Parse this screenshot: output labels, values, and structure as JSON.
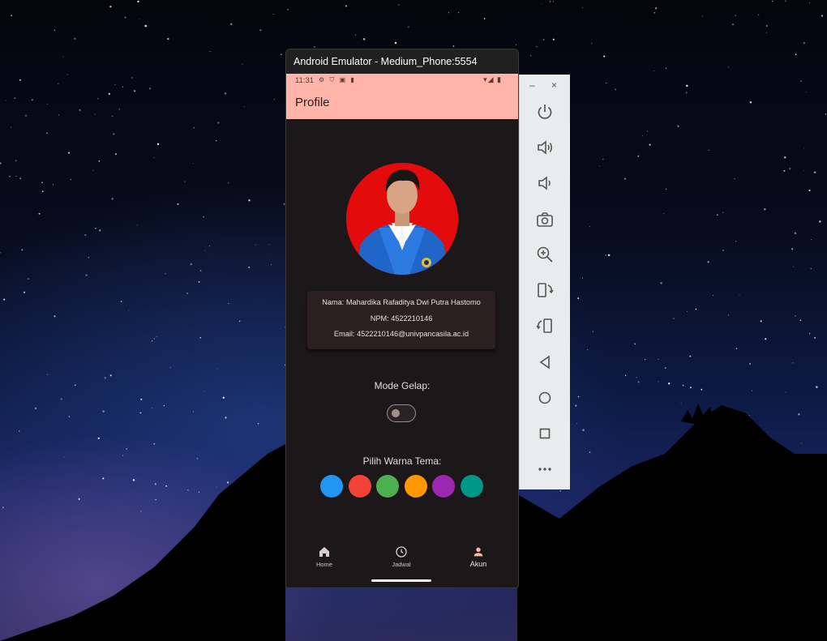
{
  "emulator": {
    "title": "Android Emulator - Medium_Phone:5554",
    "window_controls": {
      "minimize": "–",
      "close": "×"
    },
    "toolbar": [
      {
        "name": "power-icon"
      },
      {
        "name": "volume-up-icon"
      },
      {
        "name": "volume-down-icon"
      },
      {
        "name": "camera-icon"
      },
      {
        "name": "zoom-icon"
      },
      {
        "name": "rotate-left-icon"
      },
      {
        "name": "rotate-right-icon"
      },
      {
        "name": "back-icon"
      },
      {
        "name": "home-icon"
      },
      {
        "name": "overview-icon"
      },
      {
        "name": "more-icon"
      }
    ]
  },
  "status_bar": {
    "time": "11:31",
    "left_icons": "⚙ ⛉ ▣ ▮",
    "right_icons": "▾◢ ▮"
  },
  "app_bar": {
    "title": "Profile"
  },
  "profile": {
    "name_line": "Nama: Mahardika Rafaditya Dwi Putra Hastomo",
    "npm_line": "NPM: 4522210146",
    "email_line": "Email: 4522210146@univpancasila.ac.id"
  },
  "dark_mode": {
    "label": "Mode Gelap:",
    "enabled": false
  },
  "theme": {
    "label": "Pilih Warna Tema:",
    "colors": [
      "#2196f3",
      "#f44336",
      "#4caf50",
      "#ff9800",
      "#9c27b0",
      "#009688"
    ]
  },
  "bottom_nav": {
    "items": [
      {
        "label": "Home",
        "icon": "home-icon"
      },
      {
        "label": "Jadwal",
        "icon": "clock-icon"
      },
      {
        "label": "Akun",
        "icon": "person-icon",
        "active": true
      }
    ]
  },
  "colors": {
    "app_bar": "#ffb4a9",
    "background": "#1c1819",
    "card": "#2b2021"
  }
}
